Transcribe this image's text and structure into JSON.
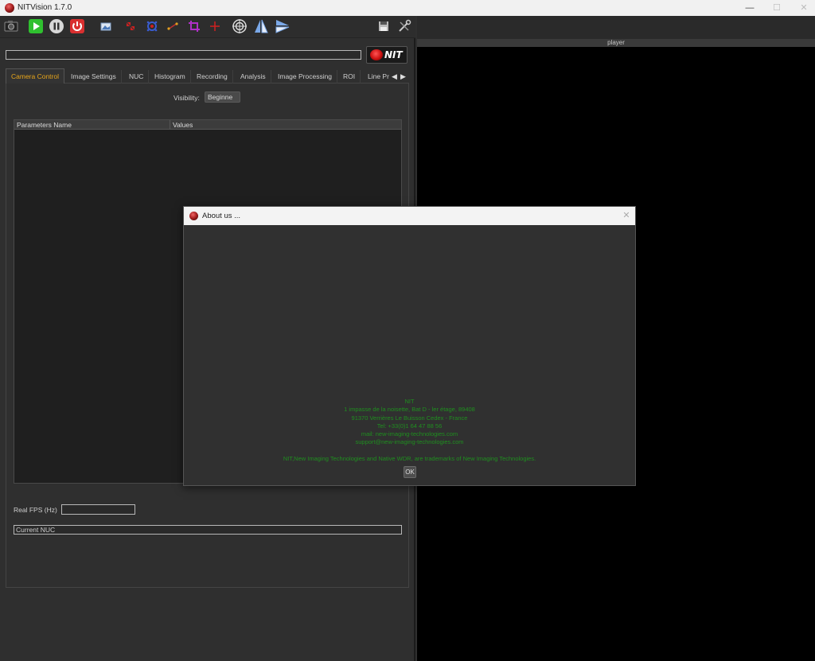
{
  "window": {
    "title": "NITVision 1.7.0",
    "minimize_glyph": "—",
    "maximize_glyph": "☐",
    "close_glyph": "✕"
  },
  "toolbar": {
    "buttons": [
      {
        "name": "camera-icon"
      },
      {
        "name": "play-icon",
        "color": "#2fc02f"
      },
      {
        "name": "pause-icon"
      },
      {
        "name": "power-icon",
        "color": "#d93030"
      },
      {
        "name": "image-icon"
      },
      {
        "name": "pixel-select-icon"
      },
      {
        "name": "bad-pixel-icon"
      },
      {
        "name": "line-profile-icon"
      },
      {
        "name": "crop-icon"
      },
      {
        "name": "crosshair-icon"
      },
      {
        "name": "target-icon"
      },
      {
        "name": "flip-vertical-icon"
      },
      {
        "name": "rotate-icon"
      },
      {
        "name": "save-icon"
      },
      {
        "name": "settings-tools-icon"
      }
    ]
  },
  "header": {
    "logo_text": "NIT"
  },
  "tabs": [
    {
      "label": "Camera Control",
      "active": true
    },
    {
      "label": "Image Settings"
    },
    {
      "label": "NUC"
    },
    {
      "label": "Histogram"
    },
    {
      "label": "Recording"
    },
    {
      "label": "Analysis"
    },
    {
      "label": "Image Processing"
    },
    {
      "label": "ROI"
    },
    {
      "label": "Line Pr"
    }
  ],
  "tab_scroll": {
    "left": "◀",
    "right": "▶"
  },
  "camera_control": {
    "visibility_label": "Visibility:",
    "visibility_value": "Beginne",
    "table_headers": [
      "Parameters Name",
      "Values"
    ],
    "real_fps_label": "Real FPS (Hz)",
    "current_nuc_label": "Current NUC"
  },
  "player": {
    "title": "player"
  },
  "about_dialog": {
    "title": "About us ...",
    "close_glyph": "✕",
    "lines": [
      "NIT",
      "1 impasse de la noisette, Bat D - ler étage, 89408",
      "91370 Verrières Le Buisson Cedex - France",
      "Tel: +33(0)1 64 47 88 56",
      "mail: new-imaging-technologies.com",
      "support@new-imaging-technologies.com"
    ],
    "trademark": "NIT,New Imaging Technologies and Native WDR, are trademarks of New Imaging Technologies.",
    "ok_label": "OK"
  },
  "colors": {
    "accent_tab": "#e7a51a",
    "about_text": "#1f8f1f",
    "background": "#2f2f2f",
    "player_bg": "#000000"
  }
}
